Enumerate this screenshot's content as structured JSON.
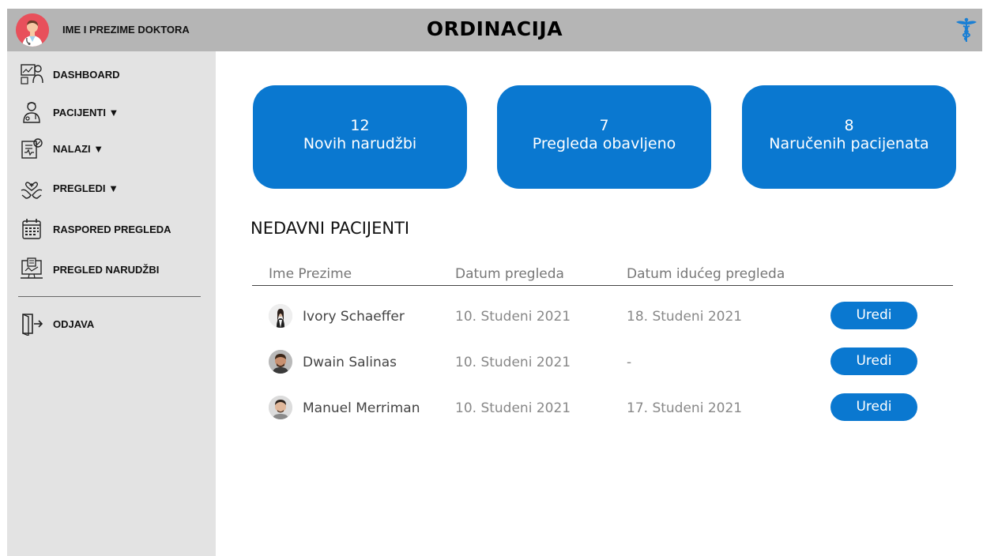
{
  "header": {
    "doctor_name": "IME I PREZIME DOKTORA",
    "title": "ORDINACIJA"
  },
  "sidebar": {
    "items": [
      {
        "label": "DASHBOARD",
        "icon": "dashboard-icon"
      },
      {
        "label": "PACIJENTI ▼",
        "icon": "patient-icon"
      },
      {
        "label": "NALAZI ▼",
        "icon": "findings-icon"
      },
      {
        "label": "PREGLEDI ▼",
        "icon": "examinations-icon"
      },
      {
        "label": "RASPORED PREGLEDA",
        "icon": "calendar-icon"
      },
      {
        "label": "PREGLED NARUDŽBI",
        "icon": "orders-icon"
      }
    ],
    "logout": {
      "label": "ODJAVA",
      "icon": "logout-icon"
    }
  },
  "stats": [
    {
      "value": "12",
      "label": "Novih narudžbi"
    },
    {
      "value": "7",
      "label": "Pregleda obavljeno"
    },
    {
      "value": "8",
      "label": "Naručenih pacijenata"
    }
  ],
  "recent": {
    "title": "NEDAVNI PACIJENTI",
    "columns": [
      "Ime Prezime",
      "Datum pregleda",
      "Datum idućeg pregleda"
    ],
    "rows": [
      {
        "name": "Ivory Schaeffer",
        "date": "10. Studeni 2021",
        "next": "18. Studeni 2021",
        "action": "Uredi"
      },
      {
        "name": "Dwain Salinas",
        "date": "10. Studeni 2021",
        "next": "-",
        "action": "Uredi"
      },
      {
        "name": "Manuel Merriman",
        "date": "10. Studeni 2021",
        "next": "17. Studeni 2021",
        "action": "Uredi"
      }
    ]
  },
  "colors": {
    "accent": "#0a78d0",
    "header_bg": "#b5b5b5",
    "sidebar_bg": "#e3e3e3",
    "caduceus": "#1a7fd4"
  }
}
